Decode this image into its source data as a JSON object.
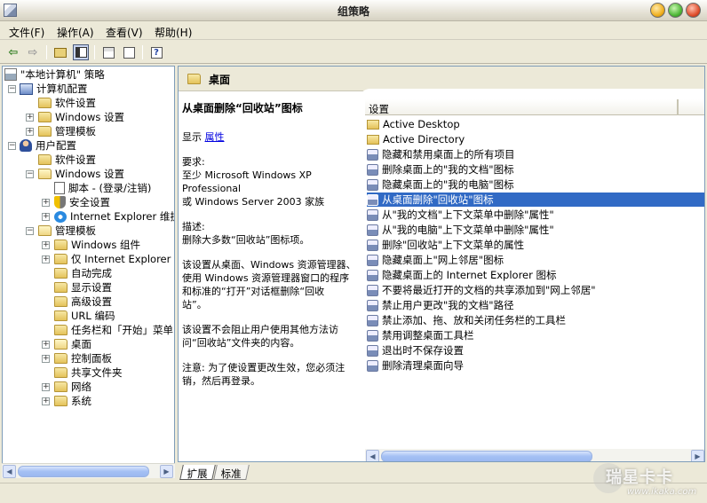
{
  "window": {
    "title": "组策略"
  },
  "menu": [
    {
      "label": "文件(F)"
    },
    {
      "label": "操作(A)"
    },
    {
      "label": "查看(V)"
    },
    {
      "label": "帮助(H)"
    }
  ],
  "toolbar": {
    "buttons": [
      "back-icon",
      "forward-icon",
      "up-folder-icon",
      "show-hide-tree-icon",
      "properties-icon",
      "export-list-icon",
      "help-icon"
    ]
  },
  "tree": {
    "root": "\"本地计算机\" 策略",
    "computer_config": "计算机配置",
    "computer_children": [
      "软件设置",
      "Windows 设置",
      "管理模板"
    ],
    "user_config": "用户配置",
    "user_software": "软件设置",
    "user_windows": "Windows 设置",
    "user_windows_children": [
      "脚本 - (登录/注销)",
      "安全设置",
      "Internet Explorer 维护"
    ],
    "admin_templates": "管理模板",
    "admin_children": [
      "Windows 组件",
      "仅 Internet Explorer 维",
      "自动完成",
      "显示设置",
      "高级设置",
      "URL 编码",
      "任务栏和「开始」菜单",
      "桌面",
      "控制面板",
      "共享文件夹",
      "网络",
      "系统"
    ]
  },
  "right_pane": {
    "header_title": "桌面",
    "description": {
      "title": "从桌面删除“回收站”图标",
      "show_label": "显示",
      "show_link": "属性",
      "req_label": "要求:",
      "req_line1": "至少 Microsoft Windows XP Professional",
      "req_line2": "或 Windows Server 2003 家族",
      "desc_label": "描述:",
      "desc_text": "删除大多数“回收站”图标项。",
      "para1_line1": "该设置从桌面、Windows 资源管理器、",
      "para1_line2": "使用 Windows 资源管理器窗口的程序",
      "para1_line3": "和标准的“打开”对话框删除“回收",
      "para1_line4": "站”。",
      "para2_line1": "该设置不会阻止用户使用其他方法访",
      "para2_line2": "问“回收站”文件夹的内容。",
      "note_line1": "注意: 为了使设置更改生效，您必须注",
      "note_line2": "销，然后再登录。"
    },
    "list_header": "设置",
    "list_items": [
      {
        "label": "Active Desktop",
        "type": "folder"
      },
      {
        "label": "Active Directory",
        "type": "folder"
      },
      {
        "label": "隐藏和禁用桌面上的所有项目",
        "type": "setting"
      },
      {
        "label": "删除桌面上的\"我的文档\"图标",
        "type": "setting"
      },
      {
        "label": "隐藏桌面上的\"我的电脑\"图标",
        "type": "setting"
      },
      {
        "label": "从桌面删除\"回收站\"图标",
        "type": "setting",
        "selected": true
      },
      {
        "label": "从\"我的文档\"上下文菜单中删除\"属性\"",
        "type": "setting"
      },
      {
        "label": "从\"我的电脑\"上下文菜单中删除\"属性\"",
        "type": "setting"
      },
      {
        "label": "删除\"回收站\"上下文菜单的属性",
        "type": "setting"
      },
      {
        "label": "隐藏桌面上\"网上邻居\"图标",
        "type": "setting"
      },
      {
        "label": "隐藏桌面上的 Internet Explorer 图标",
        "type": "setting"
      },
      {
        "label": "不要将最近打开的文档的共享添加到\"网上邻居\"",
        "type": "setting"
      },
      {
        "label": "禁止用户更改\"我的文档\"路径",
        "type": "setting"
      },
      {
        "label": "禁止添加、拖、放和关闭任务栏的工具栏",
        "type": "setting"
      },
      {
        "label": "禁用调整桌面工具栏",
        "type": "setting"
      },
      {
        "label": "退出时不保存设置",
        "type": "setting"
      },
      {
        "label": "删除清理桌面向导",
        "type": "setting"
      }
    ]
  },
  "tabs": [
    {
      "label": "扩展"
    },
    {
      "label": "标准"
    }
  ],
  "watermark": {
    "brand": "瑞星卡卡",
    "url": "www.ikaka.com"
  },
  "colors": {
    "selection": "#316ac5",
    "link": "#0000e0",
    "chrome": "#ece9d8"
  }
}
